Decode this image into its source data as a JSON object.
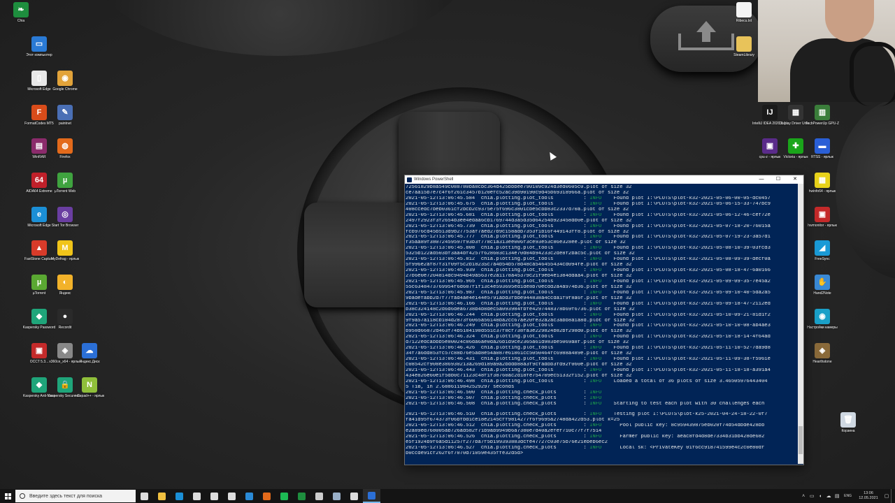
{
  "desktop": {
    "icons_left": [
      {
        "label": "Chia",
        "color": "#1e8e3e",
        "glyph": "❧"
      },
      {
        "label": "Этот компьютер",
        "color": "#2a7ad5",
        "glyph": "▭"
      },
      {
        "label": "Microsoft Edge",
        "color": "#e8e8e8",
        "glyph": "▯"
      },
      {
        "label": "Google Chrome",
        "color": "#e2a33a",
        "glyph": "◉"
      },
      {
        "label": "FormatCodes MT5",
        "color": "#d94c1a",
        "glyph": "F"
      },
      {
        "label": "paintnet",
        "color": "#4a6fb5",
        "glyph": "✎"
      },
      {
        "label": "WinRAR",
        "color": "#8b2b6b",
        "glyph": "▤"
      },
      {
        "label": "Firefox",
        "color": "#e36a1b",
        "glyph": "◍"
      },
      {
        "label": "AIDA64 Extreme",
        "color": "#c0202a",
        "glyph": "64"
      },
      {
        "label": "µTorrent Web",
        "color": "#3fa33f",
        "glyph": "µ"
      },
      {
        "label": "Microsoft Edge",
        "color": "#1b8fd6",
        "glyph": "e"
      },
      {
        "label": "Start Tor Browser",
        "color": "#6a3ea1",
        "glyph": "◎"
      },
      {
        "label": "FastStone Capture",
        "color": "#d83b2a",
        "glyph": "▲"
      },
      {
        "label": "MyDefrag - ярлык",
        "color": "#f0c419",
        "glyph": "M"
      },
      {
        "label": "µTorrent",
        "color": "#5aa832",
        "glyph": "µ"
      },
      {
        "label": "Яндекс",
        "color": "#f2b22a",
        "glyph": "◐"
      },
      {
        "label": "Kaspersky Password",
        "color": "#1fa57a",
        "glyph": "◆"
      },
      {
        "label": "Recordit",
        "color": "#2a2a2a",
        "glyph": "●"
      },
      {
        "label": "OCCT 5.3...",
        "color": "#c42a2a",
        "glyph": "▣"
      },
      {
        "label": "x360ce_x64 - ярлык",
        "color": "#888888",
        "glyph": "◈"
      },
      {
        "label": "Яндекс.Диск",
        "color": "#2b6fd6",
        "glyph": "☁"
      },
      {
        "label": "Kaspersky Anti-Virus",
        "color": "#1fa57a",
        "glyph": "◆"
      },
      {
        "label": "Kaspersky Secure C...",
        "color": "#1fa57a",
        "glyph": "🔒"
      },
      {
        "label": "notepad++ - ярлык",
        "color": "#8fbf3a",
        "glyph": "N"
      }
    ],
    "icons_right": [
      {
        "label": "Ribecu.txt",
        "color": "#f4f4f4",
        "glyph": ""
      },
      {
        "label": "SteamLibrary",
        "color": "#e8c35a",
        "glyph": ""
      },
      {
        "label": "IntelliJ IDEA 2020.1.1 x64",
        "color": "#1a1a1a",
        "glyph": "IJ"
      },
      {
        "label": "Display Driver Unin...",
        "color": "#333333",
        "glyph": "▦"
      },
      {
        "label": "TechPowerUp GPU-Z",
        "color": "#3a7d3a",
        "glyph": "▥"
      },
      {
        "label": "cpu-z - ярлык",
        "color": "#5a2b8a",
        "glyph": "▣"
      },
      {
        "label": "Victoria - ярлык",
        "color": "#1aa51a",
        "glyph": "✚"
      },
      {
        "label": "RTSS - ярлык",
        "color": "#2a5fd6",
        "glyph": "▬"
      },
      {
        "label": "hwinfo64 - ярлык",
        "color": "#e8d21a",
        "glyph": "▦"
      },
      {
        "label": "hwmonitor - ярлык",
        "color": "#c42a2a",
        "glyph": "▣"
      },
      {
        "label": "FreeSync",
        "color": "#1a9ad6",
        "glyph": "◢"
      },
      {
        "label": "Hand2Note",
        "color": "#3a8ad6",
        "glyph": "✋"
      },
      {
        "label": "Настройки камеры",
        "color": "#1aa0c8",
        "glyph": "◉"
      },
      {
        "label": "Hearthstone",
        "color": "#8a6a3a",
        "glyph": "◈"
      },
      {
        "label": "Корзина",
        "color": "#cfd8e2",
        "glyph": "🗑"
      }
    ]
  },
  "powershell": {
    "title": "Windows PowerShell",
    "lines": [
      {
        "a": "72561829b8a549c088780ba8cbc364d425bbbee790109c924d3ed0605c0.plot of size 32",
        "info": false,
        "b": ""
      },
      {
        "a": "ce7aa15b7e7c4f6f261c3457b120efc52ac39b90190c9d45b69318966a.plot of size 32",
        "info": false,
        "b": ""
      },
      {
        "a": "2021-05-12T13:06:45.584  chia.plotting.plot_tools          : ",
        "info": true,
        "b": "    Found plot I:\\PLOTS\\plot-k32-2021-05-06-00-05-dc0457"
      },
      {
        "a": "2021-05-12T13:06:45.675  chia.plotting.plot_tools          : ",
        "info": true,
        "b": "    Found plot I:\\PLOTS\\plot-k32-2021-05-06-15-33-747bc9"
      },
      {
        "a": "408ccedc7beb0361cf2bcb2c9375e75f696c3801cbe5cbb83c2337d70a.plot of size 32",
        "info": false,
        "b": ""
      },
      {
        "a": "2021-05-12T13:06:45.681  chia.plotting.plot_tools          : ",
        "info": true,
        "b": "    Found plot I:\\PLOTS\\plot-k32-2021-05-06-12-46-cef72e"
      },
      {
        "a": "2497f2923f3f2654b3ee4edaa6cb1769744d3a5d35d64254b923458db0e.plot of size 32",
        "info": false,
        "b": ""
      },
      {
        "a": "2021-05-12T13:06:45.739  chia.plotting.plot_tools          : ",
        "info": true,
        "b": "    Found plot I:\\PLOTS\\plot-k32-2021-05-07-18-20-76015a"
      },
      {
        "a": "fcb976cd45b513d9b27753af7aed27b9c158adb7353f1b16f449143ff8.plot of size 32",
        "info": false,
        "b": ""
      },
      {
        "a": "2021-05-12T13:06:45.777  chia.plotting.plot_tools          : ",
        "info": true,
        "b": "    Found plot I:\\PLOTS\\plot-k32-2021-05-07-19-23-3a57d1"
      },
      {
        "a": "f35aa89f38072459597f93b3f778c1a313ee006f3ce93e53c86e328ee.plot of size 32",
        "info": false,
        "b": ""
      },
      {
        "a": "2021-05-12T13:06:45.808  chia.plotting.plot_tools          : ",
        "info": true,
        "b": "    Found plot I:\\PLOTS\\plot-k32-2021-05-08-10-39-03fcd3"
      },
      {
        "a": "5325b122ad503bf3aa4bf4257f628603c134e70d04b94233c2de8f2bac5c.plot of size 32",
        "info": false,
        "b": ""
      },
      {
        "a": "2021-05-12T13:06:45.812  chia.plotting.plot_tools          : ",
        "info": true,
        "b": "    Found plot I:\\PLOTS\\plot-k32-2021-05-08-09-39-decf0a"
      },
      {
        "a": "5f996e2af87f31f09f5c2b1823Sc7a4b54b578d48ca546455434cd094fe.plot of size 32",
        "info": false,
        "b": ""
      },
      {
        "a": "2021-05-12T13:06:45.939  chia.plotting.plot_tools          : ",
        "info": true,
        "b": "    Found plot I:\\PLOTS\\plot-k32-2021-05-08-18-47-6a0166"
      },
      {
        "a": "27b6e0e7204814dc9494b49a5637e2a1178a45379c21f9eb4e1384ddaa4.plot of size 32",
        "info": false,
        "b": ""
      },
      {
        "a": "2021-05-12T13:06:45.965  chia.plotting.plot_tools          : ",
        "info": true,
        "b": "    Found plot I:\\PLOTS\\plot-k32-2021-05-09-09-35-7e45a2"
      },
      {
        "a": "55c6348473769954f6d687f1f13c4e593695ed1de8b70ecdd2a4a974b36.plot of size 32",
        "info": false,
        "b": ""
      },
      {
        "a": "2021-05-12T13:06:45.987  chia.plotting.plot_tools          : ",
        "info": true,
        "b": "    Found plot I:\\PLOTS\\plot-k32-2021-05-09-10-40-5da2a5"
      },
      {
        "a": "9badefabb2d7f77fad4ae4e144e5791abd3fbbe944838a4ccda1f9f8a6f.plot of size 32",
        "info": false,
        "b": ""
      },
      {
        "a": "2021-05-12T13:06:46.166  chia.plotting.plot_tools          : ",
        "info": true,
        "b": "    Found plot I:\\PLOTS\\plot-k32-2021-05-09-18-47-2112ed"
      },
      {
        "a": "b38c324148c2d6d6dea6738b4b8dec5a093984fbfe4297448378b69f6736.plot of size 32",
        "info": false,
        "b": ""
      },
      {
        "a": "2021-05-12T13:06:46.244  chia.plotting.plot_tools          : ",
        "info": true,
        "b": "    Found plot I:\\PLOTS\\plot-k32-2021-05-10-09-21-81d1f2"
      },
      {
        "a": "9f9a57a118cb104d2873f6065a56148ba2cc67ae20fe32a2ac3abb8a1a8d.plot of size 32",
        "info": false,
        "b": ""
      },
      {
        "a": "2021-05-12T13:06:46.249  chia.plotting.plot_tools          : ",
        "info": true,
        "b": "    Found plot I:\\PLOTS\\plot-k32-2021-05-10-10-08-ab4ae3"
      },
      {
        "a": "b958d66872d463f74b5184198d551c37f8cf738fa3e229824b82bf298d0.plot of size 32",
        "info": false,
        "b": ""
      },
      {
        "a": "2021-05-12T13:06:46.324  chia.plotting.plot_tools          : ",
        "info": true,
        "b": "    Found plot I:\\PLOTS\\plot-k32-2021-05-10-18-14-4f64ad"
      },
      {
        "a": "d7122edcabbb5e80024c86da6ae0da26b1d9ce2365a61d983be5069a8f.plot of size 32",
        "info": false,
        "b": ""
      },
      {
        "a": "2021-05-12T13:06:46.426  chia.plotting.plot_tools          : ",
        "info": true,
        "b": "    Found plot I:\\PLOTS\\plot-k32-2021-05-11-10-52-7da9d8"
      },
      {
        "a": "34f7a6dd853fc57c88b76e5ad8e54a087e61861cc5050464fc6988a489e.plot of size 32",
        "info": false,
        "b": ""
      },
      {
        "a": "2021-05-12T13:06:46.431  chia.plotting.plot_tools          : ",
        "info": true,
        "b": "    Found plot I:\\PLOTS\\plot-k32-2021-05-11-09-38-f5961e"
      },
      {
        "a": "c08542cf908e386930213a269d189a9a2bddb88a3f9cfadbb3fd92f060e.plot of size 32",
        "info": false,
        "b": ""
      },
      {
        "a": "2021-05-12T13:06:46.443  chia.plotting.plot_tools          : ",
        "info": true,
        "b": "    Found plot I:\\PLOTS\\plot-k32-2021-05-11-18-18-a391a4"
      },
      {
        "a": "434e826e60e1f5db0c71123c48f1f38760ac2d18fe754709ec51332f152.plot of size 32",
        "info": false,
        "b": ""
      },
      {
        "a": "2021-05-12T13:06:46.498  chia.plotting.plot_tools          : ",
        "info": true,
        "b": "    Loaded a total of 36 plots of size 3.46505976443404"
      },
      {
        "a": "5 TiB, in 2.6886119842529297 seconds",
        "info": false,
        "b": ""
      },
      {
        "a": "2021-05-12T13:06:46.500  chia.plotting.check_plots         : ",
        "info": true,
        "b": ""
      },
      {
        "a": "2021-05-12T13:06:46.507  chia.plotting.check_plots         : ",
        "info": true,
        "b": ""
      },
      {
        "a": "2021-05-12T13:06:46.508  chia.plotting.check_plots         : ",
        "info": true,
        "b": "    Starting to test each plot with 30 challenges each"
      },
      {
        "a": "",
        "info": false,
        "b": ""
      },
      {
        "a": "2021-05-12T13:06:46.510  chia.plotting.check_plots         : ",
        "info": true,
        "b": "    Testing plot I:\\PLOTS\\plot-k25-2021-04-24-18-22-0f7"
      },
      {
        "a": "fa41d95f674373f06bfbd1ce18e2145cff9814277f6f9695a2748da422d53.plot k=25",
        "info": false,
        "b": ""
      },
      {
        "a": "2021-05-12T13:06:46.512  chia.plotting.check_plots         : ",
        "info": true,
        "b": "      Pool public key: 8c959439875eb020f74d54dbde428bb"
      },
      {
        "a": "e2a89ed768005ab726ad582f71b9ab9949b6a7380e7d40a2efef710c77f7f7514",
        "info": false,
        "b": ""
      },
      {
        "a": "2021-05-12T13:06:46.526  chia.plotting.check_plots         : ",
        "info": true,
        "b": "      Farmer public key: aeac8fd4d8de7334b31bb428de682"
      },
      {
        "a": "e5f1924b9f6a5d11257f277ba7f5b199393883dcfe47727c03e75b76e21ebeb6ec2",
        "info": false,
        "b": ""
      },
      {
        "a": "2021-05-12T13:06:46.527  chia.plotting.check_plots         : ",
        "info": true,
        "b": "      Local sk: <PrivateKey 01f6cc918741599e4c2c0e80df"
      },
      {
        "a": "b0ccde91cf262f6f7070d71059e435ffe32d5d>",
        "info": false,
        "b": ""
      }
    ],
    "info_label": "INFO"
  },
  "taskbar": {
    "search_placeholder": "Введите здесь текст для поиска",
    "apps": [
      {
        "name": "task-view",
        "color": "#dddddd"
      },
      {
        "name": "file-explorer",
        "color": "#f0c040"
      },
      {
        "name": "edge",
        "color": "#1b8fd6"
      },
      {
        "name": "store",
        "color": "#dddddd"
      },
      {
        "name": "mail",
        "color": "#dddddd"
      },
      {
        "name": "snipping",
        "color": "#dddddd"
      },
      {
        "name": "app-blue",
        "color": "#2a8ad6"
      },
      {
        "name": "firefox",
        "color": "#e36a1b"
      },
      {
        "name": "spotify",
        "color": "#1db954"
      },
      {
        "name": "chia",
        "color": "#1e8e3e"
      },
      {
        "name": "terminal",
        "color": "#cccccc"
      },
      {
        "name": "steam",
        "color": "#9ab0c8"
      },
      {
        "name": "settings",
        "color": "#dddddd"
      },
      {
        "name": "powershell",
        "color": "#2b6fd6"
      }
    ],
    "tray": {
      "lang": "ENG",
      "time": "13:06",
      "date": "12.05.2021"
    }
  }
}
